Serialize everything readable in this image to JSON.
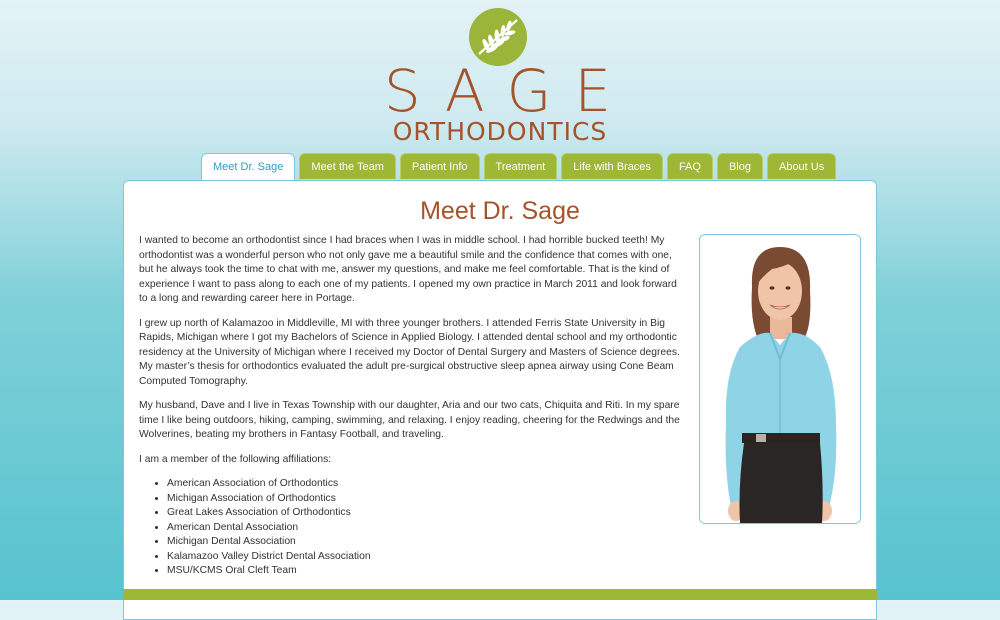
{
  "brand": {
    "name": "SAGE",
    "subtitle": "ORTHODONTICS",
    "colors": {
      "brown": "#a4532a",
      "green": "#9eb735",
      "blue": "#2e9cc8"
    }
  },
  "nav": {
    "tabs": [
      {
        "label": "Meet Dr. Sage",
        "active": true
      },
      {
        "label": "Meet the Team"
      },
      {
        "label": "Patient Info"
      },
      {
        "label": "Treatment"
      },
      {
        "label": "Life with Braces"
      },
      {
        "label": "FAQ"
      },
      {
        "label": "Blog"
      },
      {
        "label": "About Us"
      }
    ]
  },
  "main": {
    "title": "Meet Dr. Sage",
    "paragraphs": [
      "I wanted to become an orthodontist since I had braces when I was in middle school. I had horrible bucked teeth! My orthodontist was a wonderful person who not only gave me a beautiful smile and the confidence that comes with one, but he always took the time to chat with me, answer my questions, and make me feel comfortable. That is the kind of experience I want to pass along to each one of my patients. I opened my own practice in March 2011 and look forward to a long and rewarding career here in Portage.",
      "I grew up north of Kalamazoo in Middleville, MI with three younger brothers. I attended Ferris State University in Big Rapids, Michigan where I got my Bachelors of Science in Applied Biology. I attended dental school and my orthodontic residency at the University of Michigan where I received my Doctor of Dental Surgery and Masters of Science degrees. My master’s thesis for orthodontics evaluated the adult pre-surgical obstructive sleep apnea airway using Cone Beam Computed Tomography.",
      "My husband, Dave and I live in Texas Township with our daughter, Aria and our two cats, Chiquita and Riti.  In my spare time I like being outdoors, hiking, camping, swimming, and relaxing. I enjoy reading, cheering for the Redwings and the Wolverines, beating my brothers in Fantasy Football, and traveling.",
      "I am a member of the following affiliations:"
    ],
    "affiliations": [
      "American Association of Orthodontics",
      "Michigan Association of Orthodontics",
      "Great Lakes Association of Orthodontics",
      "American Dental Association",
      "Michigan Dental Association",
      "Kalamazoo Valley District Dental Association",
      "MSU/KCMS Oral Cleft Team"
    ]
  }
}
